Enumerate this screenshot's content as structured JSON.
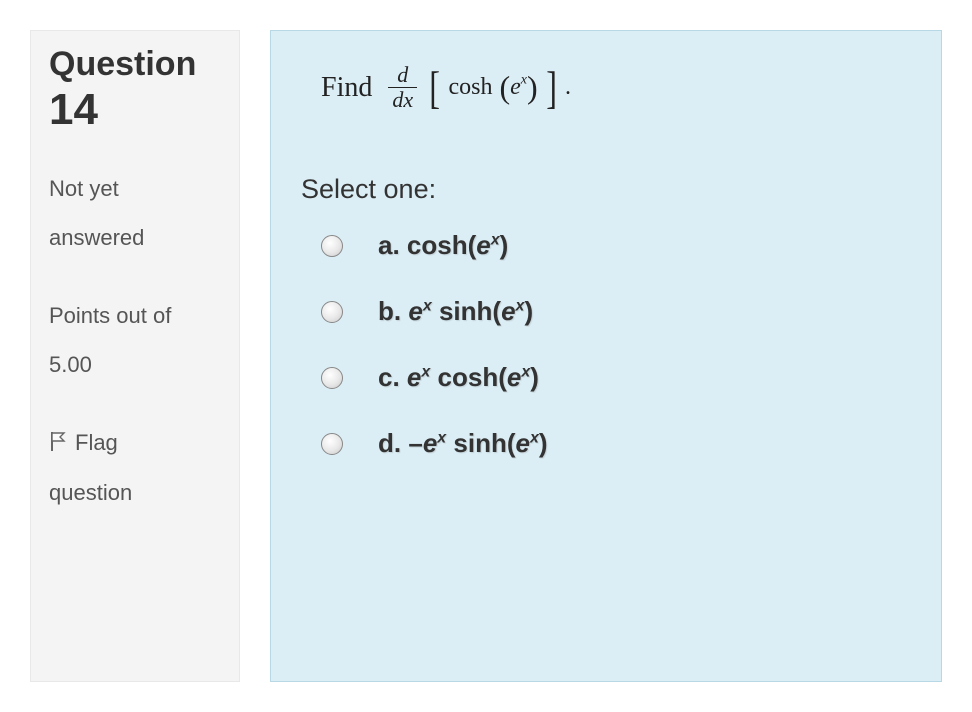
{
  "sidebar": {
    "question_label": "Question",
    "question_number": "14",
    "status_line1": "Not yet",
    "status_line2": "answered",
    "points_line1": "Points out of",
    "points_line2": "5.00",
    "flag_line1": "Flag",
    "flag_line2": "question"
  },
  "content": {
    "prompt_word": "Find",
    "frac_num": "d",
    "frac_den": "dx",
    "func": "cosh",
    "inner_base": "e",
    "inner_exp": "x",
    "select_label": "Select one:",
    "options": {
      "a": {
        "letter": "a.",
        "text_pre": "cosh(",
        "base": "e",
        "exp": "x",
        "text_post": ")"
      },
      "b": {
        "letter": "b.",
        "coef_base": "e",
        "coef_exp": "x",
        "mid": " sinh(",
        "base2": "e",
        "exp2": "x",
        "post": ")"
      },
      "c": {
        "letter": "c.",
        "coef_base": "e",
        "coef_exp": "x",
        "mid": " cosh(",
        "base2": "e",
        "exp2": "x",
        "post": ")"
      },
      "d": {
        "letter": "d.",
        "neg": "–",
        "coef_base": "e",
        "coef_exp": "x",
        "mid": " sinh(",
        "base2": "e",
        "exp2": "x",
        "post": ")"
      }
    }
  }
}
